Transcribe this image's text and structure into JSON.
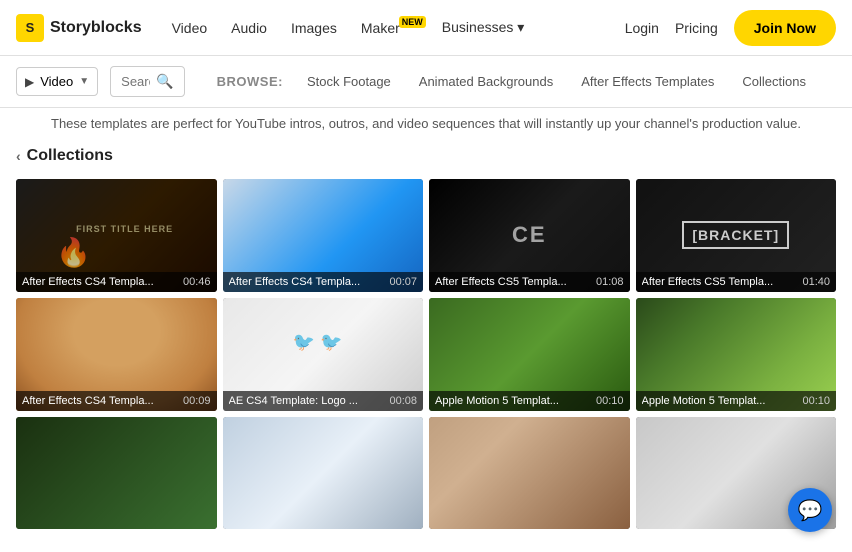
{
  "header": {
    "logo_text": "Storyblocks",
    "logo_letter": "S",
    "nav": [
      {
        "label": "Video",
        "badge": null
      },
      {
        "label": "Audio",
        "badge": null
      },
      {
        "label": "Images",
        "badge": null
      },
      {
        "label": "Maker",
        "badge": "NEW"
      },
      {
        "label": "Businesses",
        "badge": null,
        "has_arrow": true
      }
    ],
    "login": "Login",
    "pricing": "Pricing",
    "join_now": "Join Now"
  },
  "search": {
    "type": "Video",
    "placeholder": "Search...",
    "browse_label": "BROWSE:",
    "browse_links": [
      "Stock Footage",
      "Animated Backgrounds",
      "After Effects Templates",
      "Collections"
    ]
  },
  "subtitle": "These templates are perfect for YouTube intros, outros, and video sequences that will instantly up your channel's production value.",
  "collections": {
    "title": "Collections",
    "items": [
      {
        "label": "After Effects CS4 Templa...",
        "duration": "00:46",
        "thumb_class": "thumb-1"
      },
      {
        "label": "After Effects CS4 Templa...",
        "duration": "00:07",
        "thumb_class": "thumb-2"
      },
      {
        "label": "After Effects CS5 Templa...",
        "duration": "01:08",
        "thumb_class": "thumb-3"
      },
      {
        "label": "After Effects CS5 Templa...",
        "duration": "01:40",
        "thumb_class": "thumb-4"
      },
      {
        "label": "After Effects CS4 Templa...",
        "duration": "00:09",
        "thumb_class": "thumb-5"
      },
      {
        "label": "AE CS4 Template: Logo ...",
        "duration": "00:08",
        "thumb_class": "thumb-6"
      },
      {
        "label": "Apple Motion 5 Templat...",
        "duration": "00:10",
        "thumb_class": "thumb-7"
      },
      {
        "label": "Apple Motion 5 Templat...",
        "duration": "00:10",
        "thumb_class": "thumb-8"
      },
      {
        "label": "",
        "duration": "",
        "thumb_class": "thumb-9"
      },
      {
        "label": "",
        "duration": "",
        "thumb_class": "thumb-10"
      },
      {
        "label": "",
        "duration": "",
        "thumb_class": "thumb-11"
      },
      {
        "label": "",
        "duration": "",
        "thumb_class": "thumb-12"
      }
    ]
  },
  "chat": {
    "icon": "💬"
  }
}
